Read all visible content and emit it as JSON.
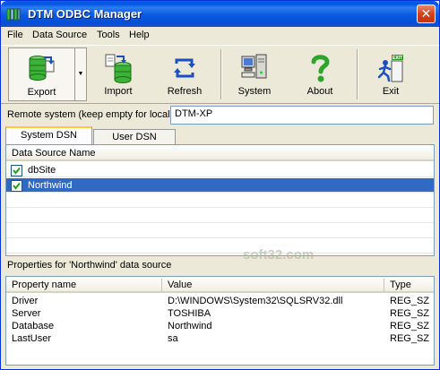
{
  "window": {
    "title": "DTM ODBC Manager",
    "close_glyph": "✕"
  },
  "menu": [
    "File",
    "Data Source",
    "Tools",
    "Help"
  ],
  "toolbar": {
    "export": "Export",
    "import": "Import",
    "refresh": "Refresh",
    "system": "System",
    "about": "About",
    "exit": "Exit",
    "exit_badge": "EXIT",
    "dropdown_glyph": "▼"
  },
  "remote": {
    "label": "Remote system (keep empty for local)",
    "value": "DTM-XP"
  },
  "tabs": {
    "system_dsn": "System DSN",
    "user_dsn": "User DSN",
    "active": "system_dsn"
  },
  "dsn_list": {
    "header": "Data Source Name",
    "rows": [
      {
        "name": "dbSite",
        "checked": true,
        "selected": false
      },
      {
        "name": "Northwind",
        "checked": true,
        "selected": true
      }
    ]
  },
  "properties": {
    "label": "Properties for 'Northwind' data source",
    "columns": [
      "Property name",
      "Value",
      "Type"
    ],
    "rows": [
      {
        "name": "Driver",
        "value": "D:\\WINDOWS\\System32\\SQLSRV32.dll",
        "type": "REG_SZ"
      },
      {
        "name": "Server",
        "value": "TOSHIBA",
        "type": "REG_SZ"
      },
      {
        "name": "Database",
        "value": "Northwind",
        "type": "REG_SZ"
      },
      {
        "name": "LastUser",
        "value": "sa",
        "type": "REG_SZ"
      }
    ]
  },
  "watermark": "soft32.com",
  "colors": {
    "titlebar": "#0054e3",
    "selection": "#316ac5",
    "tab_accent": "#ffc83c",
    "close_button": "#d3441c"
  }
}
